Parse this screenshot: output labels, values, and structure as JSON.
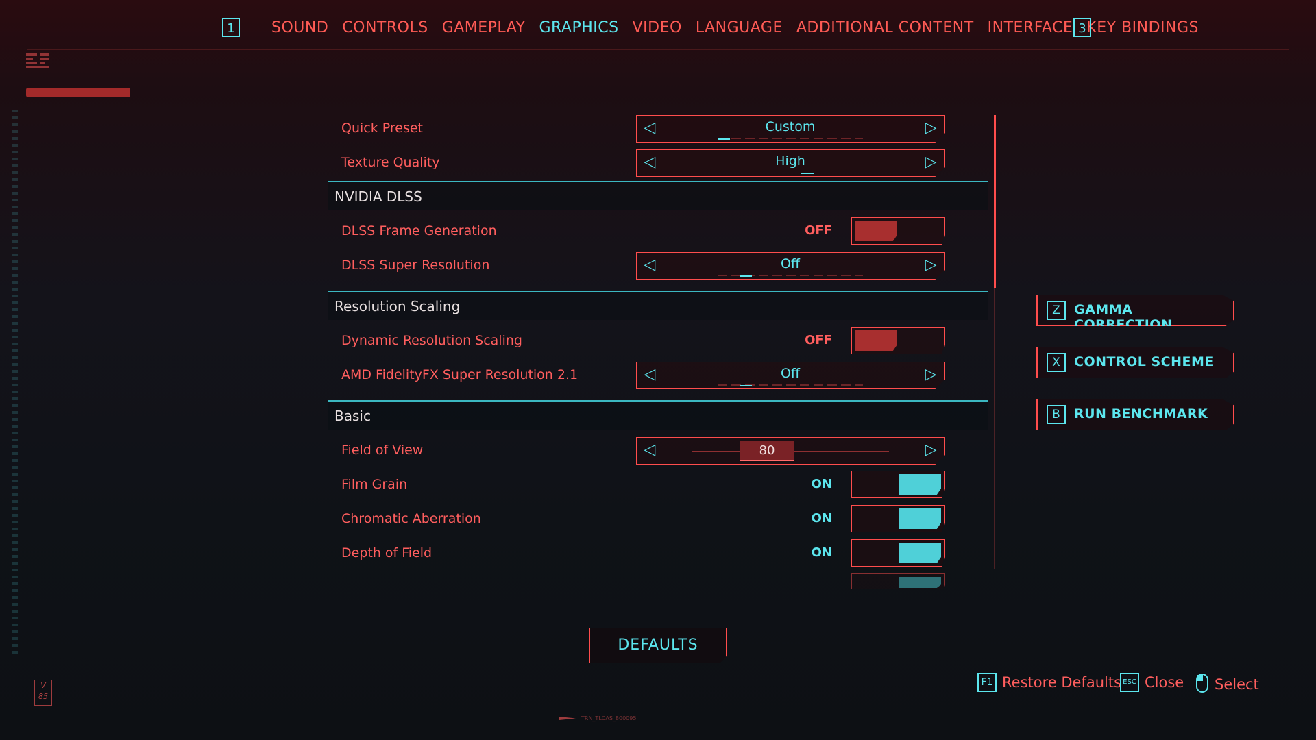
{
  "nav": {
    "prev_key": "1",
    "next_key": "3",
    "tabs": [
      "SOUND",
      "CONTROLS",
      "GAMEPLAY",
      "GRAPHICS",
      "VIDEO",
      "LANGUAGE",
      "ADDITIONAL CONTENT",
      "INTERFACE",
      "KEY BINDINGS"
    ],
    "active_tab": "GRAPHICS"
  },
  "settings": {
    "quick_preset": {
      "label": "Quick Preset",
      "value": "Custom"
    },
    "texture_quality": {
      "label": "Texture Quality",
      "value": "High"
    },
    "section_dlss": "NVIDIA DLSS",
    "dlss_frame_gen": {
      "label": "DLSS Frame Generation",
      "state": "OFF"
    },
    "dlss_super_res": {
      "label": "DLSS Super Resolution",
      "value": "Off"
    },
    "section_res": "Resolution Scaling",
    "dynamic_res": {
      "label": "Dynamic Resolution Scaling",
      "state": "OFF"
    },
    "amd_fsr": {
      "label": "AMD FidelityFX Super Resolution 2.1",
      "value": "Off"
    },
    "section_basic": "Basic",
    "fov": {
      "label": "Field of View",
      "value": "80"
    },
    "film_grain": {
      "label": "Film Grain",
      "state": "ON"
    },
    "chromatic": {
      "label": "Chromatic Aberration",
      "state": "ON"
    },
    "dof": {
      "label": "Depth of Field",
      "state": "ON"
    }
  },
  "side_buttons": [
    {
      "key": "Z",
      "label": "GAMMA CORRECTION"
    },
    {
      "key": "X",
      "label": "CONTROL SCHEME"
    },
    {
      "key": "B",
      "label": "RUN BENCHMARK"
    }
  ],
  "defaults_label": "DEFAULTS",
  "footer": {
    "restore": {
      "key": "F1",
      "label": "Restore Defaults"
    },
    "close": {
      "key": "ESC",
      "label": "Close"
    },
    "select": {
      "label": "Select"
    },
    "bottom_code": "TRN_TLCAS_800095"
  },
  "deco": {
    "v_badge": "V 85"
  },
  "colors": {
    "accent_cyan": "#5ce6ee",
    "accent_red": "#ff5e5e",
    "toggle_off": "#a82f2f",
    "toggle_on": "#4fd0d8"
  }
}
